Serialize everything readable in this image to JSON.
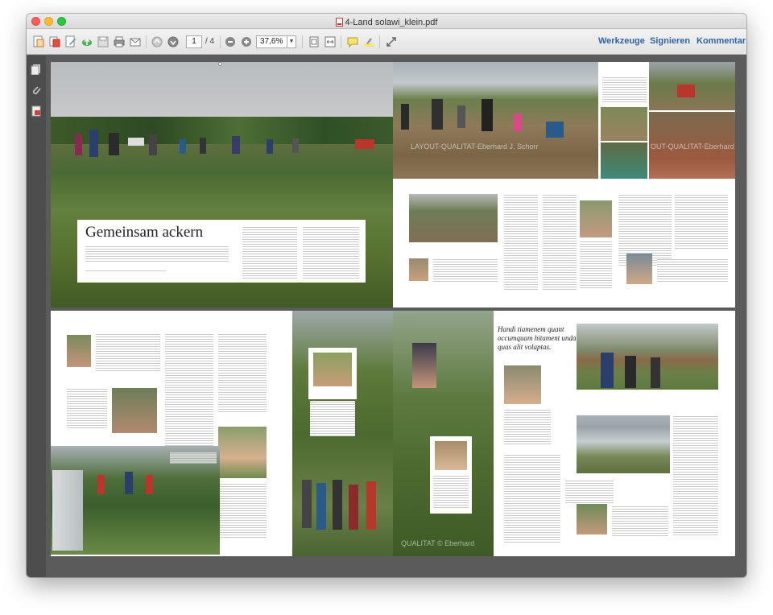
{
  "window": {
    "title": "4-Land solawi_klein.pdf"
  },
  "toolbar": {
    "page_current": "1",
    "page_total": "/ 4",
    "zoom": "37,6%",
    "links": [
      "Werkzeuge",
      "Signieren",
      "Kommentar"
    ],
    "icons": [
      "create-pdf-icon",
      "combine-icon",
      "edit-icon",
      "upload-cloud-icon",
      "save-icon",
      "print-icon",
      "email-icon",
      "page-up-icon",
      "page-down-icon",
      "zoom-out-icon",
      "zoom-in-icon",
      "fit-page-icon",
      "fit-width-icon",
      "comment-icon",
      "highlight-icon",
      "expand-icon"
    ]
  },
  "sidebar": {
    "icons": [
      "page-thumbnails-icon",
      "attachments-icon",
      "signature-icon"
    ]
  },
  "spread1": {
    "headline": "Gemeinsam ackern",
    "watermark1": "LAYOUT-QUALITAT-Eberhard J. Schorr",
    "watermark2": "OUT-QUALITAT-Eberhard J. Schorr"
  },
  "spread2": {
    "quote": "Handi tiamenem quant occumquam hitament undam quas alit volaptas.",
    "watermark": "QUALITAT © Eberhard"
  },
  "colors": {
    "accent": "#2f63a3",
    "window_bg": "#5b5b5b"
  }
}
